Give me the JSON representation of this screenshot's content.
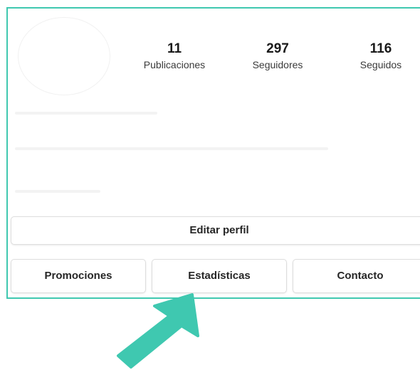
{
  "profile": {
    "stats": [
      {
        "value": "11",
        "label": "Publicaciones"
      },
      {
        "value": "297",
        "label": "Seguidores"
      },
      {
        "value": "116",
        "label": "Seguidos"
      }
    ]
  },
  "actions": {
    "edit_profile_label": "Editar perfil",
    "promotions_label": "Promociones",
    "insights_label": "Estadísticas",
    "contact_label": "Contacto"
  },
  "colors": {
    "accent": "#3fc8b0"
  },
  "pointer": {
    "icon": "arrow-pointer-icon",
    "target": "Estadísticas"
  }
}
